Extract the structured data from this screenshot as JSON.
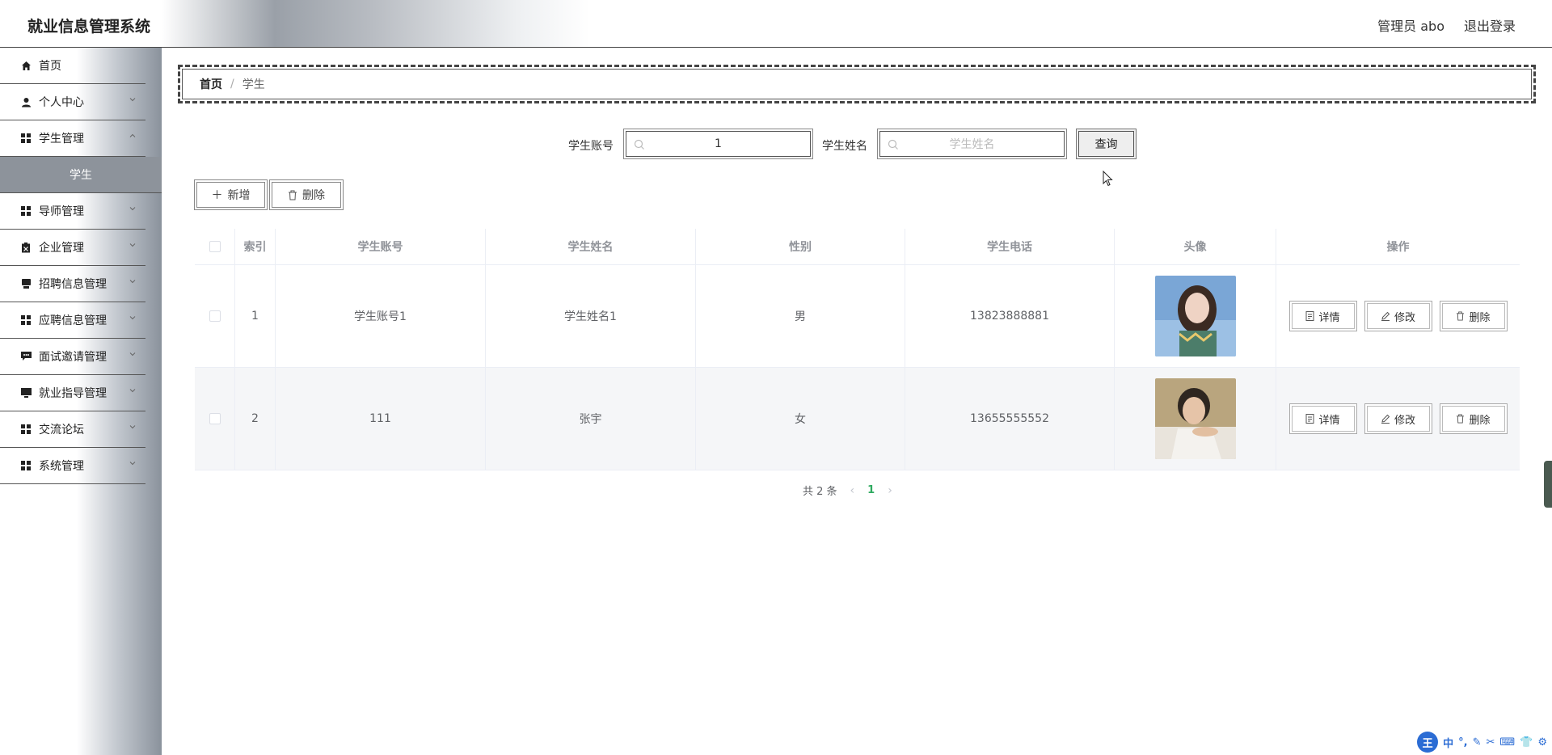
{
  "app": {
    "title": "就业信息管理系统"
  },
  "header": {
    "admin_label": "管理员 abo",
    "logout_label": "退出登录"
  },
  "sidebar": {
    "items": [
      {
        "label": "首页",
        "icon": "home-icon",
        "has_children": false
      },
      {
        "label": "个人中心",
        "icon": "user-icon",
        "has_children": true
      },
      {
        "label": "学生管理",
        "icon": "grid-icon",
        "has_children": true
      },
      {
        "label": "学生",
        "icon": "",
        "has_children": false,
        "active": true
      },
      {
        "label": "导师管理",
        "icon": "grid-icon",
        "has_children": true
      },
      {
        "label": "企业管理",
        "icon": "clipboard-icon",
        "has_children": true
      },
      {
        "label": "招聘信息管理",
        "icon": "cup-icon",
        "has_children": true
      },
      {
        "label": "应聘信息管理",
        "icon": "grid-icon",
        "has_children": true
      },
      {
        "label": "面试邀请管理",
        "icon": "chat-icon",
        "has_children": true
      },
      {
        "label": "就业指导管理",
        "icon": "monitor-icon",
        "has_children": true
      },
      {
        "label": "交流论坛",
        "icon": "grid-icon",
        "has_children": true
      },
      {
        "label": "系统管理",
        "icon": "grid-icon",
        "has_children": true
      }
    ]
  },
  "breadcrumb": {
    "home": "首页",
    "sep": "/",
    "current": "学生"
  },
  "search": {
    "account_label": "学生账号",
    "account_value": "1",
    "name_label": "学生姓名",
    "name_placeholder": "学生姓名",
    "query_label": "查询"
  },
  "toolbar": {
    "add_label": "新增",
    "delete_label": "删除"
  },
  "table": {
    "headers": [
      "索引",
      "学生账号",
      "学生姓名",
      "性别",
      "学生电话",
      "头像",
      "操作"
    ],
    "rows": [
      {
        "index": "1",
        "account": "学生账号1",
        "name": "学生姓名1",
        "gender": "男",
        "phone": "13823888881"
      },
      {
        "index": "2",
        "account": "111",
        "name": "张宇",
        "gender": "女",
        "phone": "13655555552"
      }
    ],
    "actions": {
      "detail": "详情",
      "edit": "修改",
      "delete": "删除"
    }
  },
  "pagination": {
    "total_text": "共 2 条",
    "current_page": "1"
  },
  "ime": {
    "logo": "王",
    "mode": "中"
  }
}
